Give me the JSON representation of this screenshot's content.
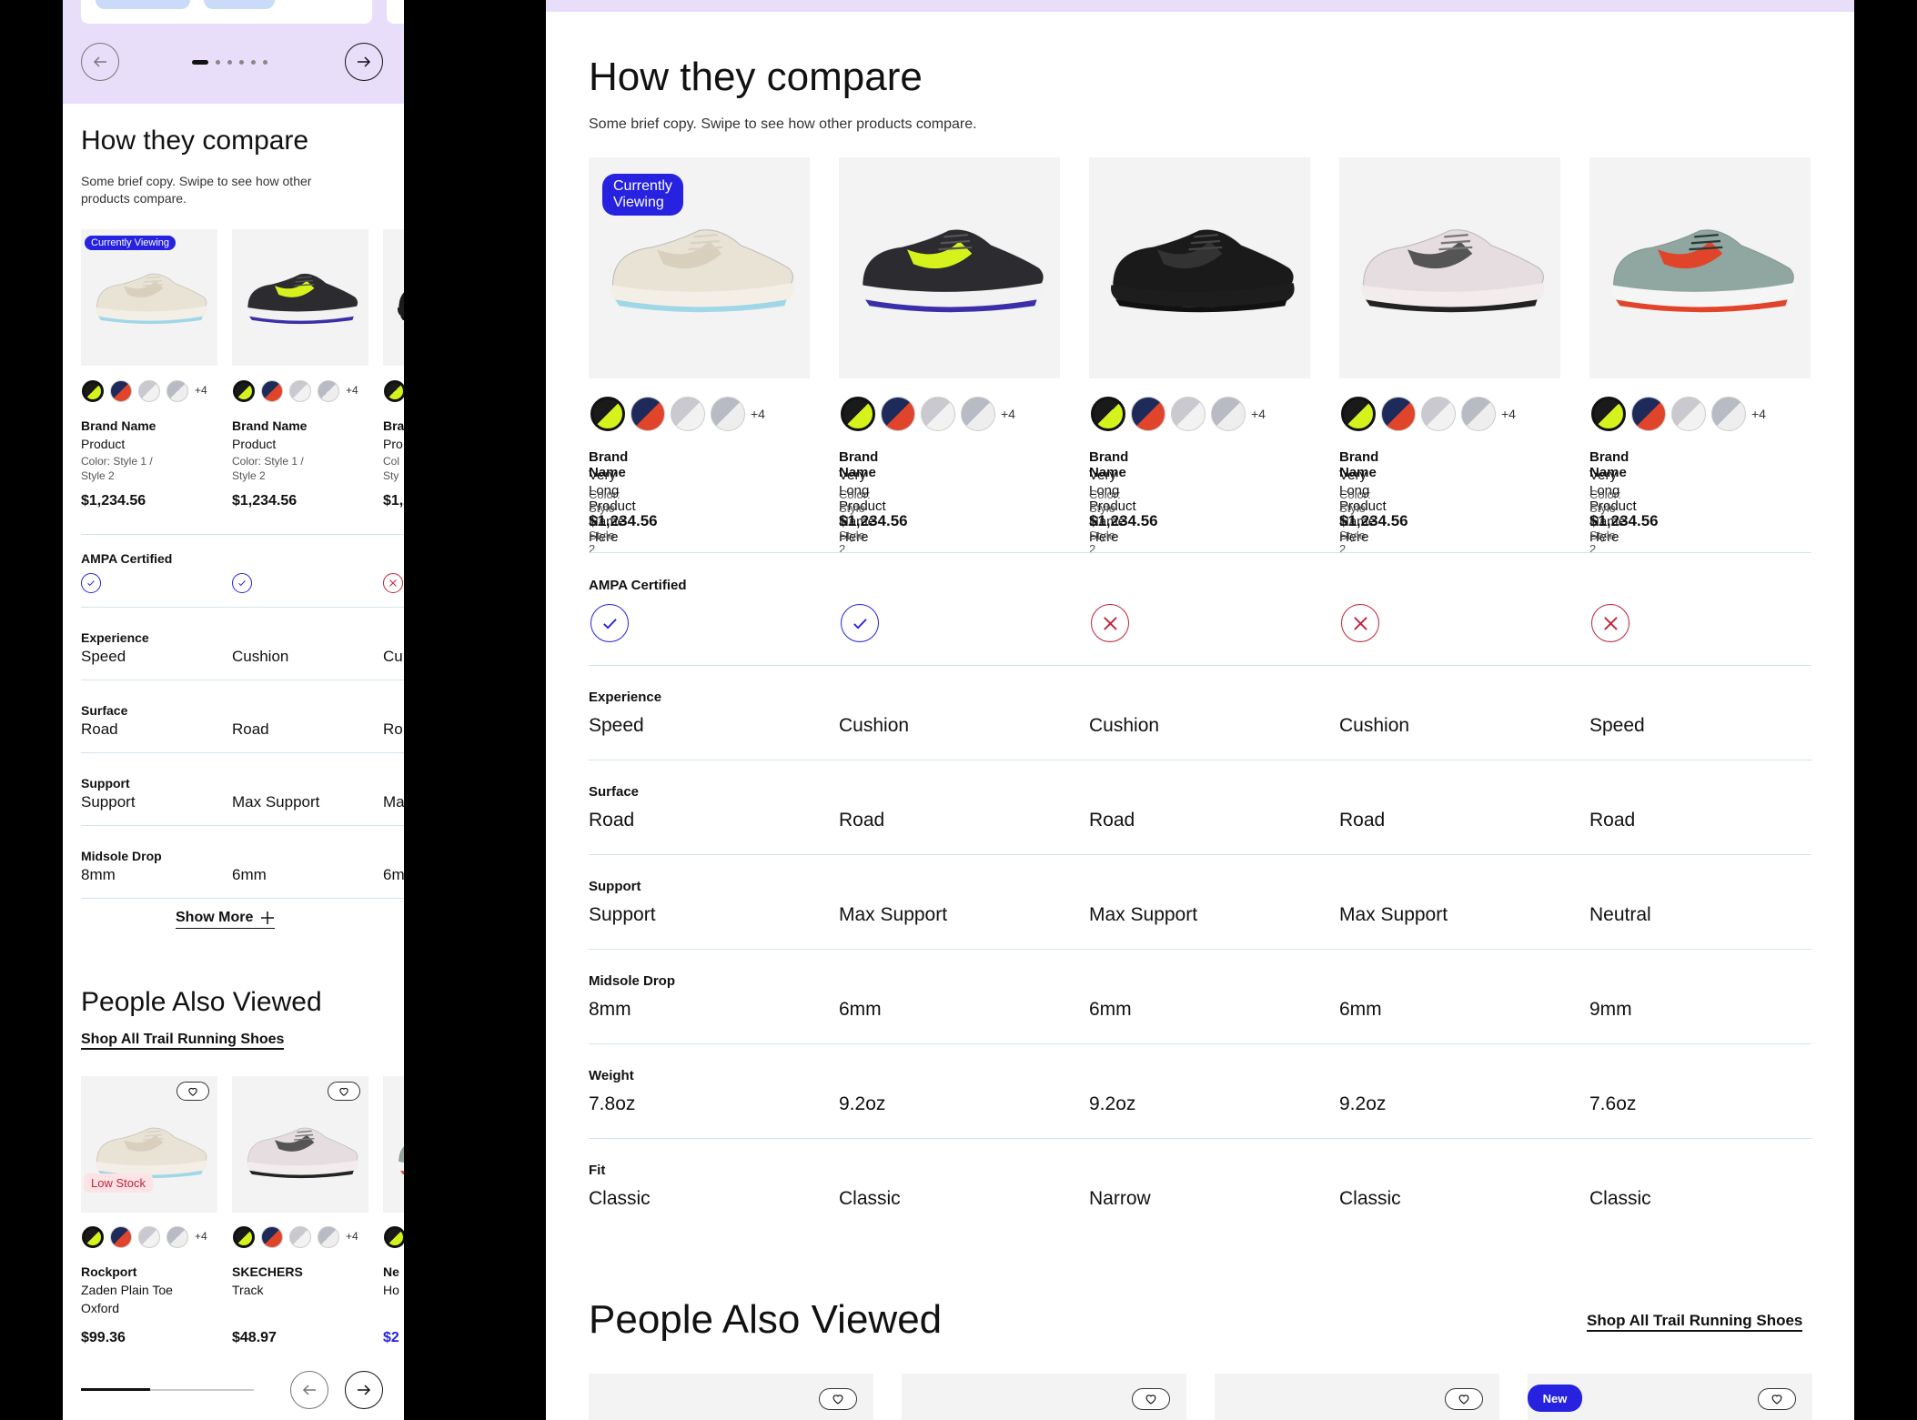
{
  "compare": {
    "title": "How they compare",
    "copy": "Some brief copy. Swipe to see how other products compare.",
    "copy_mobile_l1": "Some brief copy. Swipe to see how other",
    "copy_mobile_l2": "products compare.",
    "currently_viewing": "Currently Viewing",
    "more_swatches": "+4",
    "products": [
      {
        "brand": "Brand Name",
        "name": "Very Long Product Name Here",
        "color": "Color: Style 1 / Style 2",
        "price": "$1,234.56",
        "ampa": true,
        "experience": "Speed",
        "surface": "Road",
        "support": "Support",
        "drop": "8mm",
        "weight": "7.8oz",
        "fit": "Classic"
      },
      {
        "brand": "Brand Name",
        "name": "Very Long Product Name Here",
        "color": "Color: Style 1 / Style 2",
        "price": "$1,234.56",
        "ampa": true,
        "experience": "Cushion",
        "surface": "Road",
        "support": "Max Support",
        "drop": "6mm",
        "weight": "9.2oz",
        "fit": "Classic"
      },
      {
        "brand": "Brand Name",
        "name": "Very Long Product Name Here",
        "color": "Color: Style 1 / Style 2",
        "price": "$1,234.56",
        "ampa": false,
        "experience": "Cushion",
        "surface": "Road",
        "support": "Max Support",
        "drop": "6mm",
        "weight": "9.2oz",
        "fit": "Narrow"
      },
      {
        "brand": "Brand Name",
        "name": "Very Long Product Name Here",
        "color": "Color: Style 1 / Style 2",
        "price": "$1,234.56",
        "ampa": false,
        "experience": "Cushion",
        "surface": "Road",
        "support": "Max Support",
        "drop": "6mm",
        "weight": "9.2oz",
        "fit": "Classic"
      },
      {
        "brand": "Brand Name",
        "name": "Very Long Product Name Here",
        "color": "Color: Style 1 / Style 2",
        "price": "$1,234.56",
        "ampa": false,
        "experience": "Speed",
        "surface": "Road",
        "support": "Neutral",
        "drop": "9mm",
        "weight": "7.6oz",
        "fit": "Classic"
      }
    ],
    "mobile_products": [
      {
        "brand": "Brand Name",
        "name": "Product",
        "color_l1": "Color: Style 1 /",
        "color_l2": "Style 2",
        "price": "$1,234.56"
      },
      {
        "brand": "Brand Name",
        "name": "Product",
        "color_l1": "Color: Style 1 /",
        "color_l2": "Style 2",
        "price": "$1,234.56"
      },
      {
        "brand": "Bra",
        "name": "Pro",
        "color_l1": "Col",
        "color_l2": "Sty",
        "price": "$1,2"
      }
    ],
    "mobile_row_values": {
      "experience": [
        "Speed",
        "Cushion",
        "Cu"
      ],
      "surface": [
        "Road",
        "Road",
        "Ro"
      ],
      "support": [
        "Support",
        "Max Support",
        "Ma"
      ],
      "drop": [
        "8mm",
        "6mm",
        "6m"
      ]
    },
    "labels": {
      "ampa": "AMPA Certified",
      "experience": "Experience",
      "surface": "Surface",
      "support": "Support",
      "drop": "Midsole Drop",
      "weight": "Weight",
      "fit": "Fit"
    },
    "show_more": "Show More"
  },
  "also_viewed": {
    "title": "People Also Viewed",
    "shop_link": "Shop All Trail Running Shoes",
    "low_stock": "Low Stock",
    "new_badge": "New",
    "mobile_items": [
      {
        "brand": "Rockport",
        "name_l1": "Zaden Plain Toe",
        "name_l2": "Oxford",
        "price": "$99.36"
      },
      {
        "brand": "SKECHERS",
        "name_l1": "Track",
        "name_l2": "",
        "price": "$48.97"
      },
      {
        "brand": "Ne",
        "name_l1": "Ho",
        "name_l2": "",
        "price": "$2"
      }
    ],
    "carousel_progress": 0.4
  },
  "colors": {
    "accent": "#2622e0",
    "band": "#e8defa",
    "fail_red": "#c0223a",
    "rule": "#d4e3ea"
  }
}
